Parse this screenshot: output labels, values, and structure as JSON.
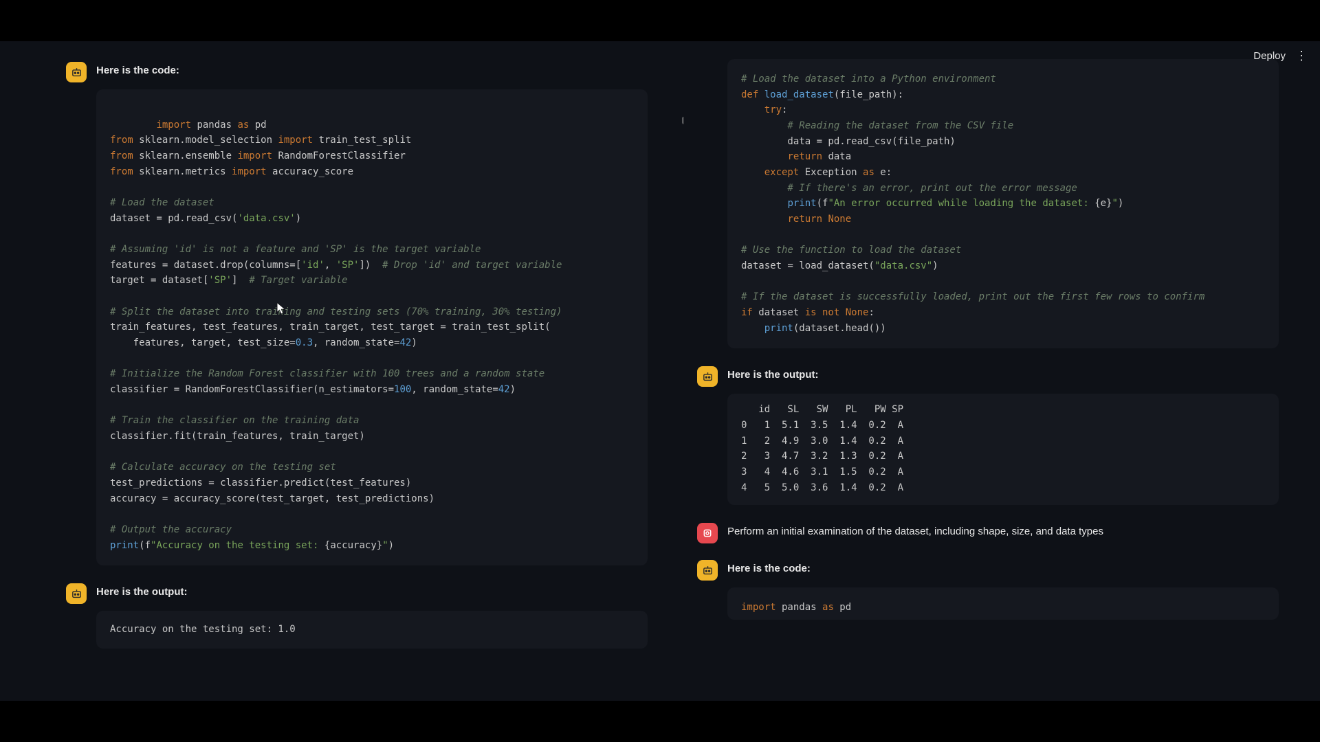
{
  "topbar": {
    "deploy": "Deploy"
  },
  "left": {
    "msg1": "Here is the code:",
    "code1": {
      "l1a": "import",
      "l1b": " pandas ",
      "l1c": "as",
      "l1d": " pd",
      "l2a": "from",
      "l2b": " sklearn.model_selection ",
      "l2c": "import",
      "l2d": " train_test_split",
      "l3a": "from",
      "l3b": " sklearn.ensemble ",
      "l3c": "import",
      "l3d": " RandomForestClassifier",
      "l4a": "from",
      "l4b": " sklearn.metrics ",
      "l4c": "import",
      "l4d": " accuracy_score",
      "c1": "# Load the dataset",
      "l5a": "dataset = pd.read_csv(",
      "l5b": "'data.csv'",
      "l5c": ")",
      "c2": "# Assuming 'id' is not a feature and 'SP' is the target variable",
      "l6a": "features = dataset.drop(columns=[",
      "l6b": "'id'",
      "l6c": ", ",
      "l6d": "'SP'",
      "l6e": "])  ",
      "l6f": "# Drop 'id' and target variable",
      "l7a": "target = dataset[",
      "l7b": "'SP'",
      "l7c": "]  ",
      "l7d": "# Target variable",
      "c3": "# Split the dataset into training and testing sets (70% training, 30% testing)",
      "l8": "train_features, test_features, train_target, test_target = train_test_split(",
      "l9a": "    features, target, test_size=",
      "l9b": "0.3",
      "l9c": ", random_state=",
      "l9d": "42",
      "l9e": ")",
      "c4": "# Initialize the Random Forest classifier with 100 trees and a random state",
      "l10a": "classifier = RandomForestClassifier(n_estimators=",
      "l10b": "100",
      "l10c": ", random_state=",
      "l10d": "42",
      "l10e": ")",
      "c5": "# Train the classifier on the training data",
      "l11": "classifier.fit(train_features, train_target)",
      "c6": "# Calculate accuracy on the testing set",
      "l12": "test_predictions = classifier.predict(test_features)",
      "l13": "accuracy = accuracy_score(test_target, test_predictions)",
      "c7": "# Output the accuracy",
      "l14a": "print",
      "l14b": "(f",
      "l14c": "\"Accuracy on the testing set: ",
      "l14d": "{accuracy}",
      "l14e": "\"",
      "l14f": ")"
    },
    "msg2": "Here is the output:",
    "out1": "Accuracy on the testing set: 1.0"
  },
  "right": {
    "code1": {
      "c1": "# Load the dataset into a Python environment",
      "l1a": "def",
      "l1b": " ",
      "l1c": "load_dataset",
      "l1d": "(file_path):",
      "l2a": "    ",
      "l2b": "try",
      "l2c": ":",
      "c2": "        # Reading the dataset from the CSV file",
      "l3": "        data = pd.read_csv(file_path)",
      "l4a": "        ",
      "l4b": "return",
      "l4c": " data",
      "l5a": "    ",
      "l5b": "except",
      "l5c": " Exception ",
      "l5d": "as",
      "l5e": " e:",
      "c3": "        # If there's an error, print out the error message",
      "l6a": "        ",
      "l6b": "print",
      "l6c": "(f",
      "l6d": "\"An error occurred while loading the dataset: ",
      "l6e": "{e}",
      "l6f": "\"",
      "l6g": ")",
      "l7a": "        ",
      "l7b": "return",
      "l7c": " ",
      "l7d": "None",
      "c4": "# Use the function to load the dataset",
      "l8a": "dataset = load_dataset(",
      "l8b": "\"data.csv\"",
      "l8c": ")",
      "c5": "# If the dataset is successfully loaded, print out the first few rows to confirm",
      "l9a": "if",
      "l9b": " dataset ",
      "l9c": "is not",
      "l9d": " ",
      "l9e": "None",
      "l9f": ":",
      "l10a": "    ",
      "l10b": "print",
      "l10c": "(dataset.head())"
    },
    "msg1": "Here is the output:",
    "out1": "   id   SL   SW   PL   PW SP\n0   1  5.1  3.5  1.4  0.2  A\n1   2  4.9  3.0  1.4  0.2  A\n2   3  4.7  3.2  1.3  0.2  A\n3   4  4.6  3.1  1.5  0.2  A\n4   5  5.0  3.6  1.4  0.2  A",
    "userMsg": "Perform an initial examination of the dataset, including shape, size, and data types",
    "msg2": "Here is the code:",
    "code2": {
      "l1a": "import",
      "l1b": " pandas ",
      "l1c": "as",
      "l1d": " pd"
    }
  },
  "chart_data": {
    "type": "table",
    "columns": [
      "id",
      "SL",
      "SW",
      "PL",
      "PW",
      "SP"
    ],
    "rows": [
      [
        1,
        5.1,
        3.5,
        1.4,
        0.2,
        "A"
      ],
      [
        2,
        4.9,
        3.0,
        1.4,
        0.2,
        "A"
      ],
      [
        3,
        4.7,
        3.2,
        1.3,
        0.2,
        "A"
      ],
      [
        4,
        4.6,
        3.1,
        1.5,
        0.2,
        "A"
      ],
      [
        5,
        5.0,
        3.6,
        1.4,
        0.2,
        "A"
      ]
    ]
  }
}
